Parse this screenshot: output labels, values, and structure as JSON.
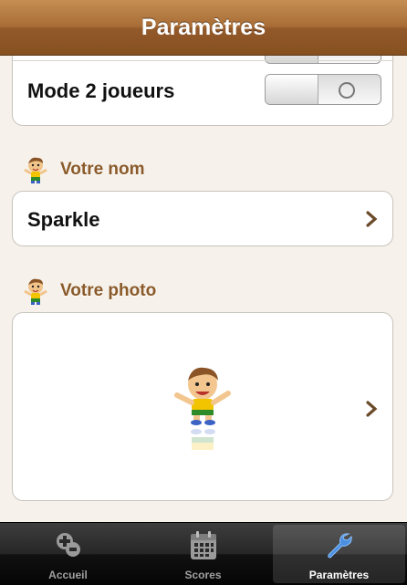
{
  "navbar": {
    "title": "Paramètres"
  },
  "settings": {
    "two_player": {
      "label": "Mode 2 joueurs",
      "enabled": false
    }
  },
  "name_section": {
    "header": "Votre nom",
    "value": "Sparkle"
  },
  "photo_section": {
    "header": "Votre photo"
  },
  "tabbar": {
    "tabs": [
      {
        "label": "Accueil",
        "icon": "home-plus-icon"
      },
      {
        "label": "Scores",
        "icon": "calendar-icon"
      },
      {
        "label": "Paramètres",
        "icon": "wrench-icon",
        "selected": true
      }
    ]
  },
  "colors": {
    "navbar": "#a86d36",
    "background": "#f6f1ea",
    "section_header": "#8a5a2a",
    "tab_selected": "#4a8fe0"
  }
}
